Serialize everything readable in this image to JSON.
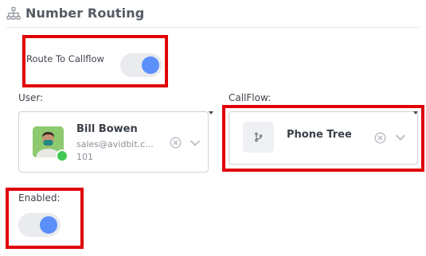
{
  "header": {
    "title": "Number Routing",
    "icon": "sitemap-icon"
  },
  "route_to_callflow": {
    "label": "Route To Callflow",
    "enabled": true
  },
  "user_field": {
    "label": "User:",
    "selected": {
      "name": "Bill Bowen",
      "email": "sales@avidbit.c...",
      "extension": "101",
      "status": "online"
    }
  },
  "callflow_field": {
    "label": "CallFlow:",
    "selected": {
      "name": "Phone Tree",
      "icon": "branch-icon"
    }
  },
  "enabled_field": {
    "label": "Enabled:",
    "enabled": true
  },
  "colors": {
    "accent": "#5b8ff9",
    "toggle_track": "#e9ebee",
    "online_status": "#40c954",
    "highlight": "#e00006"
  }
}
